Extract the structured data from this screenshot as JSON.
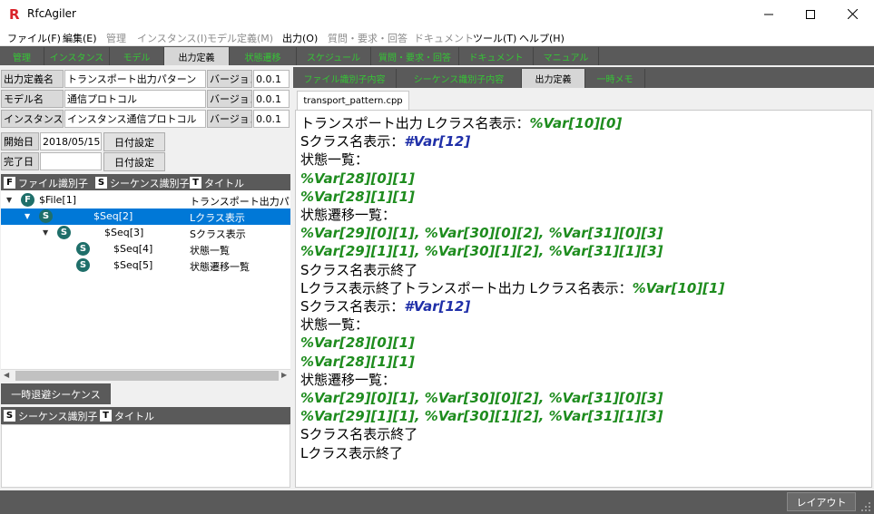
{
  "window": {
    "title": "RfcAgiler",
    "app_icon_letter": "R"
  },
  "menu": [
    {
      "label": "ファイル(F)",
      "enabled": true
    },
    {
      "label": "編集(E)",
      "enabled": true
    },
    {
      "label": "管理",
      "enabled": false
    },
    {
      "label": "インスタンス(I)",
      "enabled": false
    },
    {
      "label": "モデル定義(M)",
      "enabled": false
    },
    {
      "label": "出力(O)",
      "enabled": true
    },
    {
      "label": "質問・要求・回答",
      "enabled": false
    },
    {
      "label": "ドキュメント",
      "enabled": false
    },
    {
      "label": "ツール(T)",
      "enabled": true
    },
    {
      "label": "ヘルプ(H)",
      "enabled": true
    }
  ],
  "main_tabs": [
    "管理",
    "インスタンス",
    "モデル",
    "出力定義",
    "状態遷移",
    "スケジュール",
    "質問・要求・回答",
    "ドキュメント",
    "マニュアル"
  ],
  "main_tab_active": "出力定義",
  "form": {
    "output_name_label": "出力定義名",
    "output_name_value": "トランスポート出力パターン",
    "model_label": "モデル名",
    "model_value": "通信プロトコル",
    "instance_label": "インスタンス名",
    "instance_value": "インスタンス通信プロトコル",
    "version_label": "バージョン",
    "version1": "0.0.1",
    "version2": "0.0.1",
    "version3": "0.0.1",
    "start_label": "開始日",
    "start_value": "2018/05/15",
    "end_label": "完了日",
    "end_value": "",
    "date_button": "日付設定"
  },
  "tree_header": {
    "file_id": "ファイル識別子",
    "seq_id": "シーケンス識別子",
    "title": "タイトル",
    "badge_f": "F",
    "badge_s": "S",
    "badge_t": "T"
  },
  "tree": [
    {
      "icon": "F",
      "expanded": true,
      "id": "$File[1]",
      "title": "トランスポート出力パター",
      "selected": false
    },
    {
      "icon": "S",
      "expanded": true,
      "id": "$Seq[2]",
      "title": "Lクラス表示",
      "selected": true
    },
    {
      "icon": "S",
      "expanded": true,
      "id": "$Seq[3]",
      "title": "Sクラス表示",
      "selected": false
    },
    {
      "icon": "S",
      "expanded": false,
      "id": "$Seq[4]",
      "title": "状態一覧",
      "selected": false
    },
    {
      "icon": "S",
      "expanded": false,
      "id": "$Seq[5]",
      "title": "状態遷移一覧",
      "selected": false
    }
  ],
  "lower": {
    "tab": "一時退避シーケンス",
    "seq_id": "シーケンス識別子",
    "title": "タイトル"
  },
  "right_tabs": [
    "ファイル識別子内容",
    "シーケンス識別子内容",
    "出力定義",
    "一時メモ"
  ],
  "right_tab_active": "出力定義",
  "file_tab": "transport_pattern.cpp",
  "editor_lines": [
    [
      {
        "t": "トランスポート出力 Lクラス名表示："
      },
      {
        "t": "%Var[10][0]",
        "c": "g"
      }
    ],
    [
      {
        "t": "Sクラス名表示："
      },
      {
        "t": "#Var[12]",
        "c": "b"
      }
    ],
    [
      {
        "t": "状態一覧："
      }
    ],
    [
      {
        "t": "%Var[28][0][1]",
        "c": "g"
      }
    ],
    [
      {
        "t": "%Var[28][1][1]",
        "c": "g"
      }
    ],
    [
      {
        "t": "状態遷移一覧："
      }
    ],
    [
      {
        "t": "%Var[29][0][1]",
        "c": "g"
      },
      {
        "t": ", ",
        "c": "g"
      },
      {
        "t": "%Var[30][0][2]",
        "c": "g"
      },
      {
        "t": ", ",
        "c": "g"
      },
      {
        "t": "%Var[31][0][3]",
        "c": "g"
      }
    ],
    [
      {
        "t": "%Var[29][1][1]",
        "c": "g"
      },
      {
        "t": ", ",
        "c": "g"
      },
      {
        "t": "%Var[30][1][2]",
        "c": "g"
      },
      {
        "t": ", ",
        "c": "g"
      },
      {
        "t": "%Var[31][1][3]",
        "c": "g"
      }
    ],
    [
      {
        "t": "Sクラス名表示終了"
      }
    ],
    [
      {
        "t": "Lクラス表示終了トランスポート出力 Lクラス名表示："
      },
      {
        "t": "%Var[10][1]",
        "c": "g"
      }
    ],
    [
      {
        "t": "Sクラス名表示："
      },
      {
        "t": "#Var[12]",
        "c": "b"
      }
    ],
    [
      {
        "t": "状態一覧："
      }
    ],
    [
      {
        "t": "%Var[28][0][1]",
        "c": "g"
      }
    ],
    [
      {
        "t": "%Var[28][1][1]",
        "c": "g"
      }
    ],
    [
      {
        "t": "状態遷移一覧："
      }
    ],
    [
      {
        "t": "%Var[29][0][1]",
        "c": "g"
      },
      {
        "t": ", ",
        "c": "g"
      },
      {
        "t": "%Var[30][0][2]",
        "c": "g"
      },
      {
        "t": ", ",
        "c": "g"
      },
      {
        "t": "%Var[31][0][3]",
        "c": "g"
      }
    ],
    [
      {
        "t": "%Var[29][1][1]",
        "c": "g"
      },
      {
        "t": ", ",
        "c": "g"
      },
      {
        "t": "%Var[30][1][2]",
        "c": "g"
      },
      {
        "t": ", ",
        "c": "g"
      },
      {
        "t": "%Var[31][1][3]",
        "c": "g"
      }
    ],
    [
      {
        "t": "Sクラス名表示終了"
      }
    ],
    [
      {
        "t": "Lクラス表示終了"
      }
    ]
  ],
  "status_button": "レイアウト",
  "colors": {
    "accent_green": "#35c635",
    "var_green": "#1e8c1e",
    "var_blue": "#1f2fa8",
    "selection": "#0078d7",
    "dark_bar": "#5a5a5a"
  }
}
